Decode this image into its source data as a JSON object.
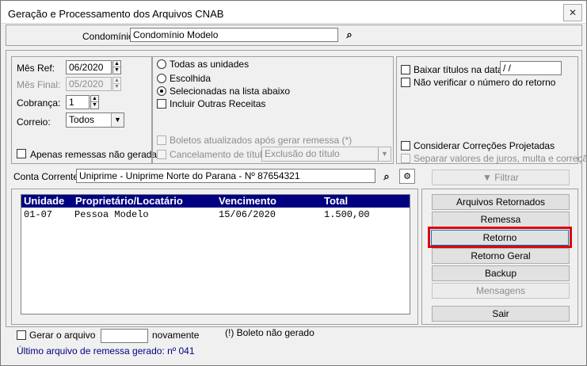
{
  "window": {
    "title": "Geração e Processamento dos Arquivos CNAB",
    "close_label": "✕"
  },
  "condominio": {
    "label": "Condomínio:",
    "value": "Condomínio Modelo"
  },
  "filters": {
    "mes_ref": {
      "label": "Mês Ref:",
      "value": "06/2020"
    },
    "mes_final": {
      "label": "Mês Final:",
      "value": "05/2020"
    },
    "cobranca": {
      "label": "Cobrança:",
      "value": "1"
    },
    "correio": {
      "label": "Correio:",
      "value": "Todos"
    },
    "apenas_remessas": "Apenas remessas não geradas"
  },
  "unidades": {
    "todas": "Todas as unidades",
    "escolhida": "Escolhida",
    "selecionadas": "Selecionadas na lista abaixo",
    "incluir_outras": "Incluir Outras Receitas",
    "boletos_atualizados": "Boletos atualizados após gerar remessa (*)",
    "cancelamento": "Cancelamento de título",
    "cancelamento_value": "Exclusão do título"
  },
  "options": {
    "baixar": "Baixar títulos na data:",
    "baixar_value": " / /",
    "nao_verificar": "Não verificar o número do retorno",
    "considerar": "Considerar Correções Projetadas",
    "separar": "Separar valores de juros, multa e correção"
  },
  "conta": {
    "label": "Conta Corrente:",
    "value": "Uniprime - Uniprime Norte do Parana - Nº 87654321"
  },
  "filtrar_label": "Filtrar",
  "grid": {
    "headers": [
      "Unidade",
      "Proprietário/Locatário",
      "Vencimento",
      "Total"
    ],
    "rows": [
      [
        "01-07",
        "Pessoa Modelo",
        "15/06/2020",
        "1.500,00"
      ]
    ]
  },
  "buttons": {
    "arquivos_retornados": "Arquivos Retornados",
    "remessa": "Remessa",
    "retorno": "Retorno",
    "retorno_geral": "Retorno Geral",
    "backup": "Backup",
    "mensagens": "Mensagens",
    "sair": "Sair"
  },
  "footer": {
    "gerar": "Gerar o arquivo",
    "gerar_value": "",
    "novamente": "novamente",
    "boleto_nao_gerado": "(!) Boleto não gerado",
    "ultimo": "Último arquivo de remessa gerado: nº 041"
  },
  "colors": {
    "grid_header": "#000080",
    "highlight": "#e00000",
    "link": "#000080"
  }
}
